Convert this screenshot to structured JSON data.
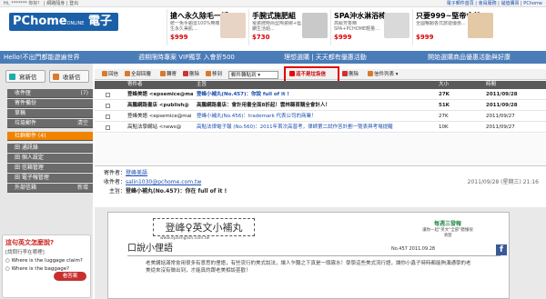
{
  "topbar": {
    "left": "Hi, ******* 你好！ | 網路隨身 | 登出",
    "right": "電子郵件首頁 | 會員服務 | 儲值購買 | PChome"
  },
  "logo": {
    "brand": "PChome",
    "sub": "ONLINE",
    "title": "電子郵件"
  },
  "ads": [
    {
      "title": "搶へ永久除毛一折",
      "desc": "統一免手顆雷100%無痛生永久美肌...",
      "price": "$999"
    },
    {
      "title": "手腕式施肥組",
      "desc": "電瓷牌時尚型陶瓷碗+藍鑽生活組...",
      "price": "$730"
    },
    {
      "title": "SPA沖水淋浴椅",
      "desc": "高級芳香精SPA+PCHOME輕量...",
      "price": "$999"
    },
    {
      "title": "只要999~堅帝會館",
      "desc": "全國暢銷各式旅遊優惠...",
      "price": "$999"
    }
  ],
  "promobar": [
    "Hello!不出門都能遊遍世界",
    "週期限時專案 VIP獨享 入會折500",
    "理想選購 | 天天都有優惠活動",
    "開始選購商品優惠活動與好康"
  ],
  "sidebar": {
    "compose": "寫新信",
    "receive": "收新信",
    "folders": [
      {
        "label": "收件匣",
        "count": "(7)"
      },
      {
        "label": "寄件備份",
        "count": ""
      },
      {
        "label": "草稿",
        "count": ""
      },
      {
        "label": "垃圾郵件",
        "count": "清空"
      },
      {
        "label": "社群郵件 (4)",
        "count": "",
        "active": true
      },
      {
        "label": "田 通訊錄",
        "count": ""
      },
      {
        "label": "田 個人設定",
        "count": ""
      },
      {
        "label": "田 信箱管理",
        "count": ""
      },
      {
        "label": "田 電子報管理",
        "count": ""
      },
      {
        "label": "外部信箱",
        "count": "新增"
      }
    ],
    "quiz": {
      "title": "這句英文怎麼說?",
      "sub": "[請問行李在哪裡]",
      "a1": "Where is the luggage claim?",
      "a2": "Where is the baggage?",
      "btn": "看答案"
    }
  },
  "toolbar": {
    "items": [
      "回信",
      "全部回覆",
      "轉寄",
      "刪除",
      "移到",
      "列印",
      "更多"
    ],
    "select": "郵件轉貼到",
    "highlight": "這不是垃圾信",
    "delete2": "刪除",
    "list": "信件列表"
  },
  "table": {
    "headers": [
      "寄件者",
      "主旨",
      "大小",
      "時間"
    ],
    "rows": [
      {
        "from": "登峰美語 <epsemice@mail",
        "subject": "登峰小補丸(No.457)：你說 full of it !",
        "size": "27K",
        "time": "2011/09/28"
      },
      {
        "from": "高鵬網路書店 <publish@",
        "subject": "高鵬網路書店：會計用書全面8折起！雲林縣首購全會計人！",
        "size": "51K",
        "time": "2011/09/28"
      },
      {
        "from": "登峰美語 <epsemice@mai",
        "subject": "登峰小補丸(No.456)：trademark 代表公司的商業！",
        "size": "27K",
        "time": "2011/09/27"
      },
      {
        "from": "高點法學網站 <news@",
        "subject": "高點法律電子報 (No.560)：2011年首次高普考，律師第二試作答計劃一覽表與考場提醒",
        "size": "10K",
        "time": "2011/09/27"
      }
    ]
  },
  "read": {
    "from_label": "寄件者：",
    "from": "登峰美語",
    "to_label": "收件者：",
    "to": "salin1030@pchome.com.tw",
    "subj_label": "主旨：",
    "subject": "登峰小補丸(No.457)：你在 full of it !",
    "time": "2011/09/28 (星期三) 21:16"
  },
  "newsletter": {
    "title": "登峰♀英文小補丸",
    "url": "www.epsenglish.com.tw",
    "weekly": "每週三發報",
    "weekly2": "讓你一起\"英文\"全部\"聽懂很清楚",
    "section": "口說小俚語",
    "no": "No.457",
    "date": "2011.09.28",
    "para": "老美講話滿常會用很多有意思的俚語，有些流行的美式說法，讓人乍聽之下真是一頭霧水！學學這些美式流行語，讓你小鑫子時時都能夠溝通學的老美從來沒有做出到，才能真的跟老美相談甚歡！"
  }
}
